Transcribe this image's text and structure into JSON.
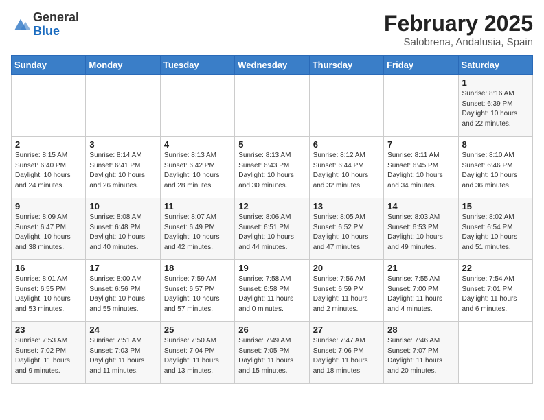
{
  "header": {
    "logo": {
      "general": "General",
      "blue": "Blue"
    },
    "title": "February 2025",
    "subtitle": "Salobrena, Andalusia, Spain"
  },
  "weekdays": [
    "Sunday",
    "Monday",
    "Tuesday",
    "Wednesday",
    "Thursday",
    "Friday",
    "Saturday"
  ],
  "weeks": [
    [
      {
        "day": "",
        "info": ""
      },
      {
        "day": "",
        "info": ""
      },
      {
        "day": "",
        "info": ""
      },
      {
        "day": "",
        "info": ""
      },
      {
        "day": "",
        "info": ""
      },
      {
        "day": "",
        "info": ""
      },
      {
        "day": "1",
        "info": "Sunrise: 8:16 AM\nSunset: 6:39 PM\nDaylight: 10 hours\nand 22 minutes."
      }
    ],
    [
      {
        "day": "2",
        "info": "Sunrise: 8:15 AM\nSunset: 6:40 PM\nDaylight: 10 hours\nand 24 minutes."
      },
      {
        "day": "3",
        "info": "Sunrise: 8:14 AM\nSunset: 6:41 PM\nDaylight: 10 hours\nand 26 minutes."
      },
      {
        "day": "4",
        "info": "Sunrise: 8:13 AM\nSunset: 6:42 PM\nDaylight: 10 hours\nand 28 minutes."
      },
      {
        "day": "5",
        "info": "Sunrise: 8:13 AM\nSunset: 6:43 PM\nDaylight: 10 hours\nand 30 minutes."
      },
      {
        "day": "6",
        "info": "Sunrise: 8:12 AM\nSunset: 6:44 PM\nDaylight: 10 hours\nand 32 minutes."
      },
      {
        "day": "7",
        "info": "Sunrise: 8:11 AM\nSunset: 6:45 PM\nDaylight: 10 hours\nand 34 minutes."
      },
      {
        "day": "8",
        "info": "Sunrise: 8:10 AM\nSunset: 6:46 PM\nDaylight: 10 hours\nand 36 minutes."
      }
    ],
    [
      {
        "day": "9",
        "info": "Sunrise: 8:09 AM\nSunset: 6:47 PM\nDaylight: 10 hours\nand 38 minutes."
      },
      {
        "day": "10",
        "info": "Sunrise: 8:08 AM\nSunset: 6:48 PM\nDaylight: 10 hours\nand 40 minutes."
      },
      {
        "day": "11",
        "info": "Sunrise: 8:07 AM\nSunset: 6:49 PM\nDaylight: 10 hours\nand 42 minutes."
      },
      {
        "day": "12",
        "info": "Sunrise: 8:06 AM\nSunset: 6:51 PM\nDaylight: 10 hours\nand 44 minutes."
      },
      {
        "day": "13",
        "info": "Sunrise: 8:05 AM\nSunset: 6:52 PM\nDaylight: 10 hours\nand 47 minutes."
      },
      {
        "day": "14",
        "info": "Sunrise: 8:03 AM\nSunset: 6:53 PM\nDaylight: 10 hours\nand 49 minutes."
      },
      {
        "day": "15",
        "info": "Sunrise: 8:02 AM\nSunset: 6:54 PM\nDaylight: 10 hours\nand 51 minutes."
      }
    ],
    [
      {
        "day": "16",
        "info": "Sunrise: 8:01 AM\nSunset: 6:55 PM\nDaylight: 10 hours\nand 53 minutes."
      },
      {
        "day": "17",
        "info": "Sunrise: 8:00 AM\nSunset: 6:56 PM\nDaylight: 10 hours\nand 55 minutes."
      },
      {
        "day": "18",
        "info": "Sunrise: 7:59 AM\nSunset: 6:57 PM\nDaylight: 10 hours\nand 57 minutes."
      },
      {
        "day": "19",
        "info": "Sunrise: 7:58 AM\nSunset: 6:58 PM\nDaylight: 11 hours\nand 0 minutes."
      },
      {
        "day": "20",
        "info": "Sunrise: 7:56 AM\nSunset: 6:59 PM\nDaylight: 11 hours\nand 2 minutes."
      },
      {
        "day": "21",
        "info": "Sunrise: 7:55 AM\nSunset: 7:00 PM\nDaylight: 11 hours\nand 4 minutes."
      },
      {
        "day": "22",
        "info": "Sunrise: 7:54 AM\nSunset: 7:01 PM\nDaylight: 11 hours\nand 6 minutes."
      }
    ],
    [
      {
        "day": "23",
        "info": "Sunrise: 7:53 AM\nSunset: 7:02 PM\nDaylight: 11 hours\nand 9 minutes."
      },
      {
        "day": "24",
        "info": "Sunrise: 7:51 AM\nSunset: 7:03 PM\nDaylight: 11 hours\nand 11 minutes."
      },
      {
        "day": "25",
        "info": "Sunrise: 7:50 AM\nSunset: 7:04 PM\nDaylight: 11 hours\nand 13 minutes."
      },
      {
        "day": "26",
        "info": "Sunrise: 7:49 AM\nSunset: 7:05 PM\nDaylight: 11 hours\nand 15 minutes."
      },
      {
        "day": "27",
        "info": "Sunrise: 7:47 AM\nSunset: 7:06 PM\nDaylight: 11 hours\nand 18 minutes."
      },
      {
        "day": "28",
        "info": "Sunrise: 7:46 AM\nSunset: 7:07 PM\nDaylight: 11 hours\nand 20 minutes."
      },
      {
        "day": "",
        "info": ""
      }
    ]
  ]
}
